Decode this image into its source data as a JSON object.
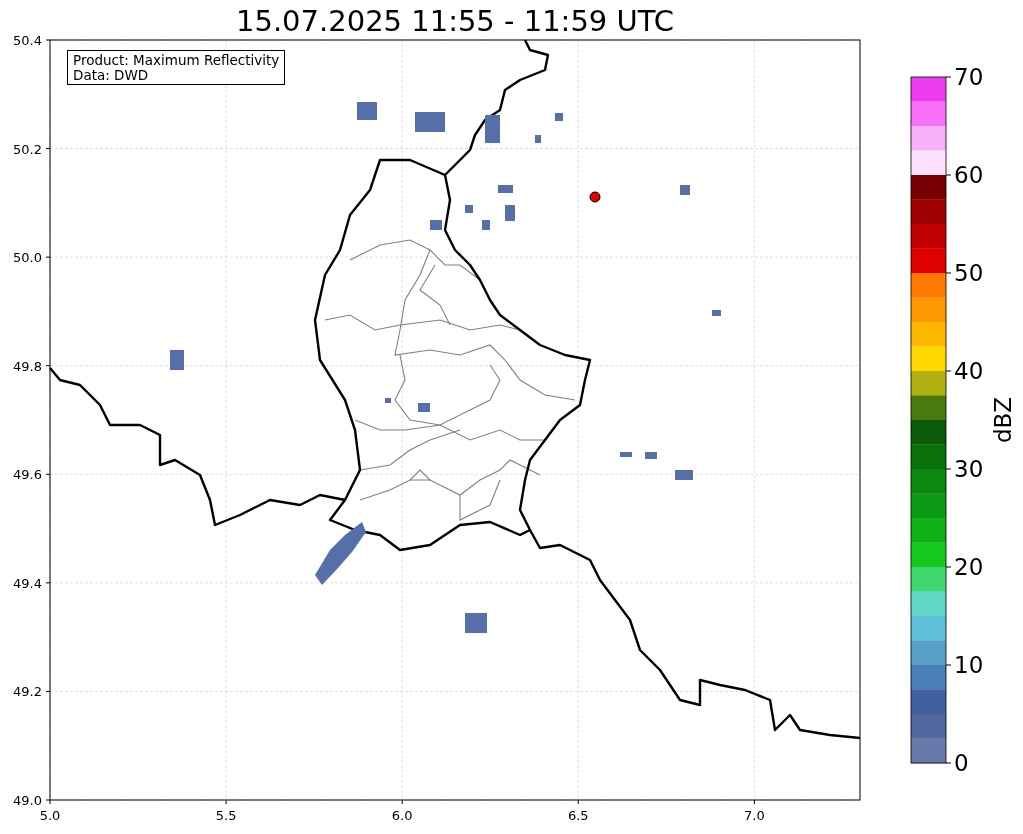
{
  "title": "15.07.2025 11:55 - 11:59 UTC",
  "legend": [
    "Product: Maximum Reflectivity",
    "Data: DWD"
  ],
  "map": {
    "x_ticks": [
      "5.0",
      "5.5",
      "6.0",
      "6.5",
      "7.0"
    ],
    "y_ticks": [
      "50.4",
      "50.2",
      "50.0",
      "49.8",
      "49.6",
      "49.4",
      "49.2",
      "49.0"
    ]
  },
  "colorbar": {
    "label": "dBZ",
    "ticks": [
      "70",
      "60",
      "50",
      "40",
      "30",
      "20",
      "10",
      "0"
    ],
    "bins": [
      {
        "color": "#f03cf0"
      },
      {
        "color": "#f870f8"
      },
      {
        "color": "#f8b0f8"
      },
      {
        "color": "#fde0fd"
      },
      {
        "color": "#780000"
      },
      {
        "color": "#a00000"
      },
      {
        "color": "#c00000"
      },
      {
        "color": "#e00000"
      },
      {
        "color": "#ff7800"
      },
      {
        "color": "#ff9800"
      },
      {
        "color": "#ffb800"
      },
      {
        "color": "#ffd800"
      },
      {
        "color": "#b0b010"
      },
      {
        "color": "#4a7a10"
      },
      {
        "color": "#0a5a0a"
      },
      {
        "color": "#0a700a"
      },
      {
        "color": "#0a8810"
      },
      {
        "color": "#0a9a14"
      },
      {
        "color": "#10b018"
      },
      {
        "color": "#14c81c"
      },
      {
        "color": "#40d870"
      },
      {
        "color": "#60d8c8"
      },
      {
        "color": "#60c0dc"
      },
      {
        "color": "#58a0c8"
      },
      {
        "color": "#4a80b8"
      },
      {
        "color": "#4060a0"
      },
      {
        "color": "#5068a0"
      },
      {
        "color": "#6878a8"
      }
    ]
  }
}
